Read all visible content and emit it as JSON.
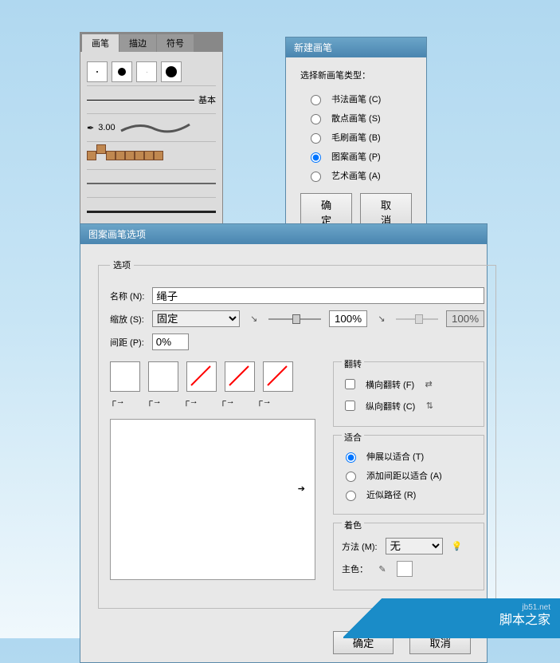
{
  "brushPanel": {
    "tabs": [
      "画笔",
      "描边",
      "符号"
    ],
    "basicLabel": "基本",
    "sizeLabel": "3.00"
  },
  "newBrush": {
    "title": "新建画笔",
    "prompt": "选择新画笔类型：",
    "options": [
      {
        "label": "书法画笔 (C)",
        "checked": false
      },
      {
        "label": "散点画笔 (S)",
        "checked": false
      },
      {
        "label": "毛刷画笔 (B)",
        "checked": false
      },
      {
        "label": "图案画笔 (P)",
        "checked": true
      },
      {
        "label": "艺术画笔 (A)",
        "checked": false
      }
    ],
    "ok": "确定",
    "cancel": "取消"
  },
  "options": {
    "title": "图案画笔选项",
    "groupLabel": "选项",
    "name": {
      "label": "名称 (N):",
      "value": "绳子"
    },
    "scale": {
      "label": "缩放 (S):",
      "mode": "固定",
      "value": "100%",
      "value2": "100%"
    },
    "spacing": {
      "label": "间距 (P):",
      "value": "0%"
    },
    "flip": {
      "legend": "翻转",
      "h": {
        "label": "横向翻转 (F)"
      },
      "v": {
        "label": "纵向翻转 (C)"
      }
    },
    "fit": {
      "legend": "适合",
      "o1": {
        "label": "伸展以适合 (T)",
        "checked": true
      },
      "o2": {
        "label": "添加间距以适合 (A)"
      },
      "o3": {
        "label": "近似路径 (R)"
      }
    },
    "color": {
      "legend": "着色",
      "methodLabel": "方法 (M):",
      "method": "无",
      "keyLabel": "主色："
    },
    "ok": "确定",
    "cancel": "取消"
  },
  "watermark": {
    "site": "jb51.net",
    "text": "脚本之家"
  }
}
